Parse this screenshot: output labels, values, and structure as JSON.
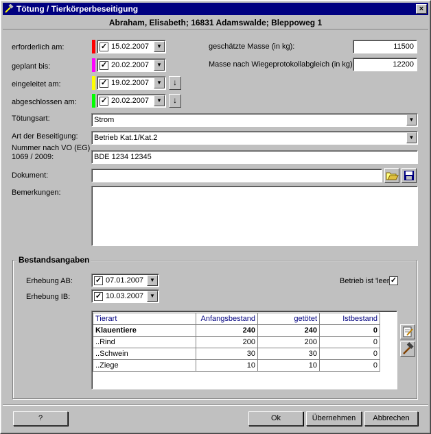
{
  "window": {
    "title": "Tötung / Tierkörperbeseitigung",
    "close_glyph": "×",
    "header": "Abraham, Elisabeth; 16831 Adamswalde; Bleppoweg 1"
  },
  "dates": {
    "erforderlich": {
      "label": "erforderlich am:",
      "value": "15.02.2007",
      "checked": "✓",
      "color": "#ff0000"
    },
    "geplant": {
      "label": "geplant bis:",
      "value": "20.02.2007",
      "checked": "✓",
      "color": "#ff00ff"
    },
    "eingeleitet": {
      "label": "eingeleitet am:",
      "value": "19.02.2007",
      "checked": "✓",
      "color": "#ffff00"
    },
    "abgeschlossen": {
      "label": "abgeschlossen am:",
      "value": "20.02.2007",
      "checked": "✓",
      "color": "#00ff00"
    }
  },
  "arrow_glyph": "↓",
  "masse": {
    "geschaetzt_label": "geschätzte Masse (in kg):",
    "geschaetzt_value": "11500",
    "wiege_label": "Masse nach Wiegeprotokollabgleich (in kg):",
    "wiege_value": "12200"
  },
  "toetungsart": {
    "label": "Tötungsart:",
    "value": "Strom"
  },
  "beseitigung": {
    "label": "Art der Beseitigung:",
    "value": "Betrieb Kat.1/Kat.2"
  },
  "nummer": {
    "label_line1": "Nummer nach VO (EG)",
    "label_line2": "1069 / 2009:",
    "value": "BDE 1234 12345"
  },
  "dokument": {
    "label": "Dokument:",
    "value": ""
  },
  "bemerkungen": {
    "label": "Bemerkungen:",
    "value": ""
  },
  "bestand": {
    "title": "Bestandsangaben",
    "erhebung_ab": {
      "label": "Erhebung AB:",
      "value": "07.01.2007",
      "checked": "✓"
    },
    "erhebung_ib": {
      "label": "Erhebung IB:",
      "value": "10.03.2007",
      "checked": "✓"
    },
    "leer_label": "Betrieb ist 'leer'",
    "leer_checked": "✓",
    "columns": [
      "Tierart",
      "Anfangsbestand",
      "getötet",
      "Istbestand"
    ],
    "rows": [
      {
        "tierart": "Klauentiere",
        "anfang": "240",
        "getoetet": "240",
        "ist": "0"
      },
      {
        "tierart": "..Rind",
        "anfang": "200",
        "getoetet": "200",
        "ist": "0"
      },
      {
        "tierart": "..Schwein",
        "anfang": "30",
        "getoetet": "30",
        "ist": "0"
      },
      {
        "tierart": "..Ziege",
        "anfang": "10",
        "getoetet": "10",
        "ist": "0"
      }
    ]
  },
  "buttons": {
    "help": "?",
    "ok": "Ok",
    "uebernehmen": "Übernehmen",
    "abbrechen": "Abbrechen"
  },
  "icons": {
    "title": "hammer-icon",
    "open": "folder-open-icon",
    "save": "save-disk-icon",
    "edit": "edit-notepad-icon",
    "hammer": "hammer-icon"
  }
}
